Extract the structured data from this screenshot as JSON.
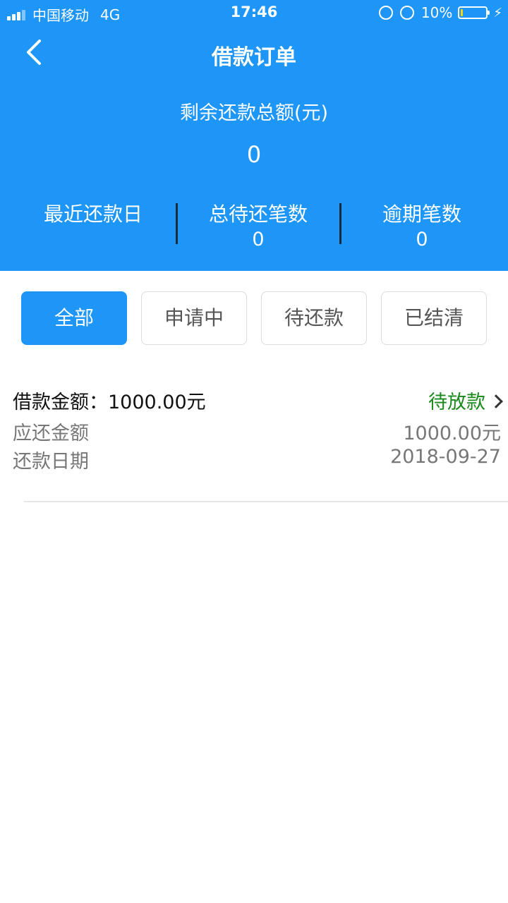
{
  "status_bar": {
    "carrier": "中国移动",
    "network": "4G",
    "time": "17:46",
    "battery": "10%",
    "battery_level": 0.1
  },
  "nav": {
    "title": "借款订单",
    "back_icon": "chevron-left-icon"
  },
  "summary": {
    "total_label": "剩余还款总额(元)",
    "total_value": "0",
    "stats": [
      {
        "label": "最近还款日",
        "value": ""
      },
      {
        "label": "总待还笔数",
        "value": "0"
      },
      {
        "label": "逾期笔数",
        "value": "0"
      }
    ]
  },
  "tabs": [
    {
      "label": "全部",
      "active": true
    },
    {
      "label": "申请中",
      "active": false
    },
    {
      "label": "待还款",
      "active": false
    },
    {
      "label": "已结清",
      "active": false
    }
  ],
  "orders": [
    {
      "amount_label": "借款金额：",
      "amount_value": "1000.00元",
      "status": "待放款",
      "due_label": "应还金额",
      "due_value": "1000.00元",
      "date_label": "还款日期",
      "date_value": "2018-09-27"
    }
  ],
  "colors": {
    "primary": "#1e96f7",
    "status_pending": "#1a8a1a"
  }
}
